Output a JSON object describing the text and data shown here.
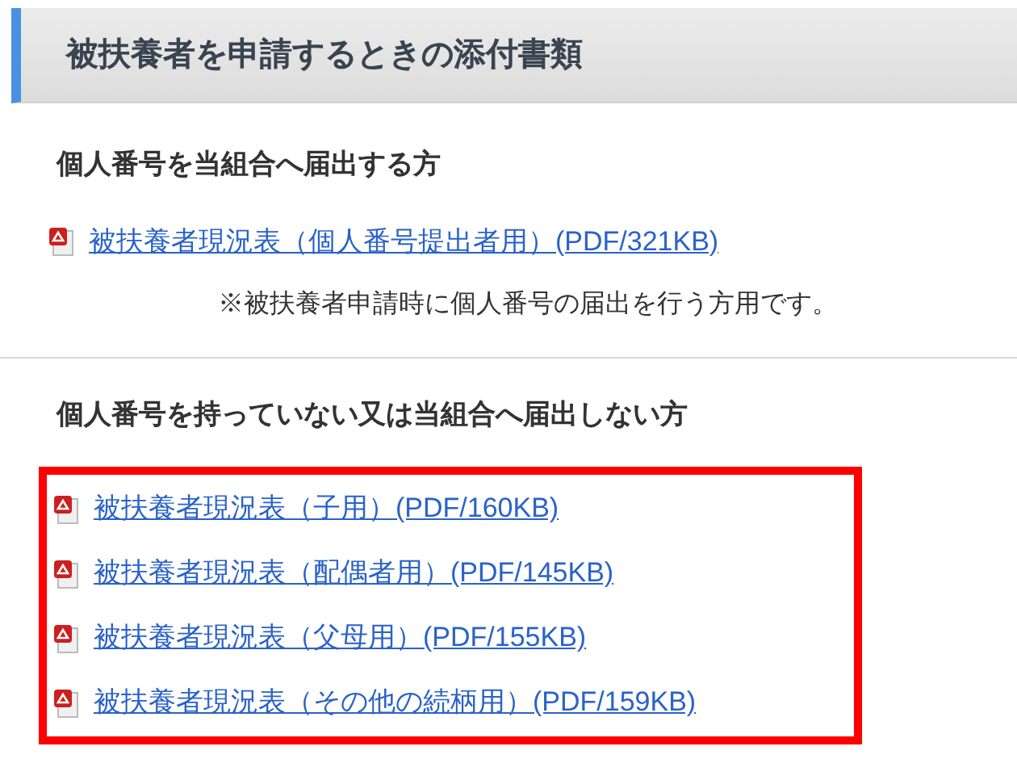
{
  "title": "被扶養者を申請するときの添付書類",
  "sections": [
    {
      "heading": "個人番号を当組合へ届出する方",
      "highlighted": false,
      "links": [
        {
          "text": "被扶養者現況表（個人番号提出者用）(PDF/321KB)"
        }
      ],
      "note": "※被扶養者申請時に個人番号の届出を行う方用です。"
    },
    {
      "heading": "個人番号を持っていない又は当組合へ届出しない方",
      "highlighted": true,
      "links": [
        {
          "text": "被扶養者現況表（子用）(PDF/160KB)"
        },
        {
          "text": "被扶養者現況表（配偶者用）(PDF/145KB)"
        },
        {
          "text": "被扶養者現況表（父母用）(PDF/155KB)"
        },
        {
          "text": "被扶養者現況表（その他の続柄用）(PDF/159KB)"
        }
      ]
    }
  ]
}
